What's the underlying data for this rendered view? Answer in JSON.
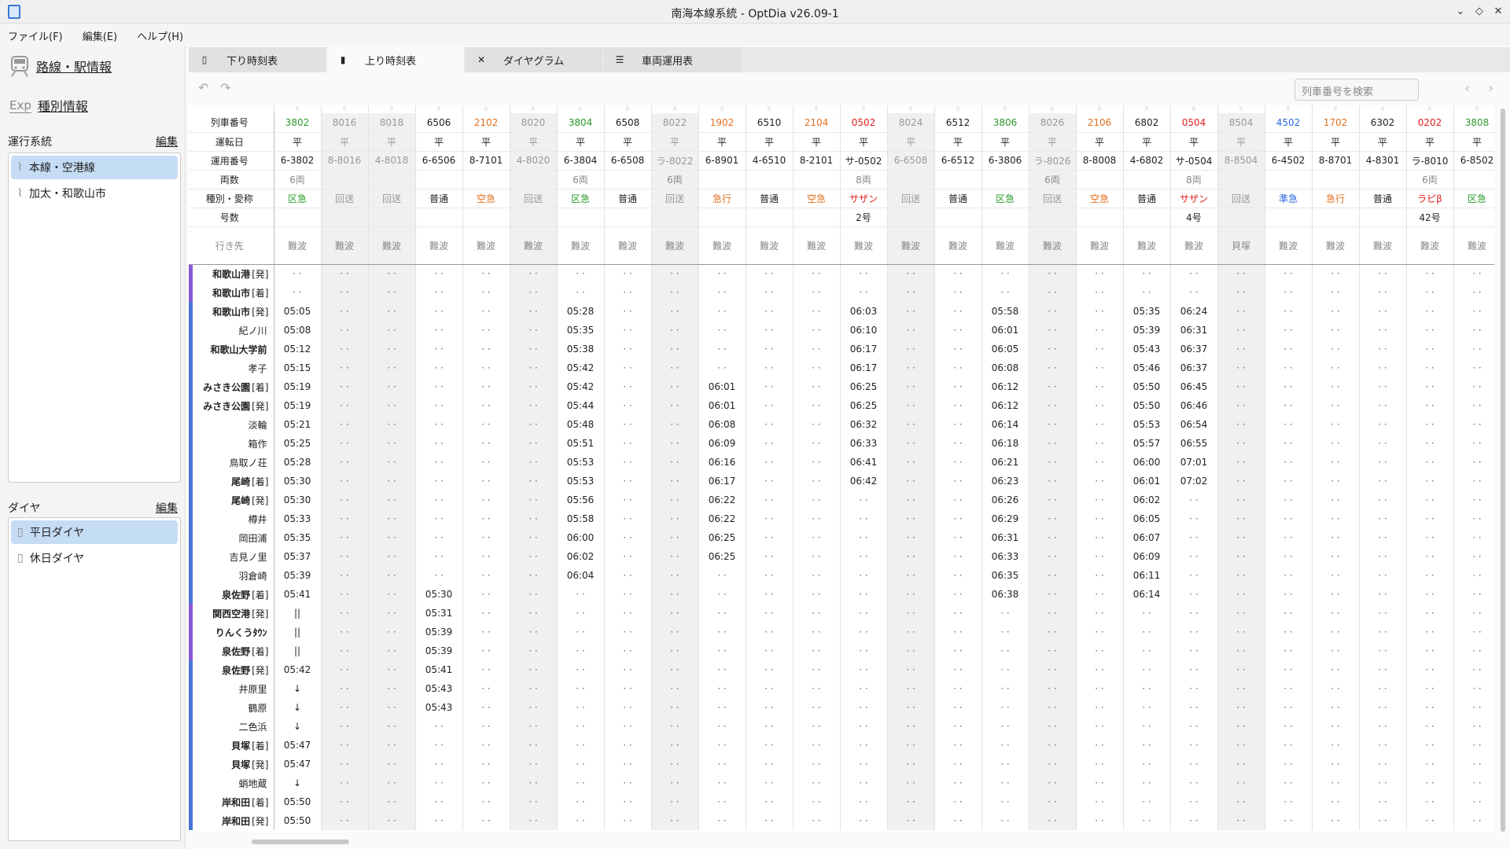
{
  "window": {
    "title": "南海本線系統 - OptDia v26.09-1",
    "controls": [
      "⌄",
      "◇",
      "✕"
    ]
  },
  "menu": [
    "ファイル(F)",
    "編集(E)",
    "ヘルプ(H)"
  ],
  "sidebar": {
    "route_info": "路線・駅情報",
    "type_info": "種別情報",
    "systems_label": "運行系統",
    "systems_edit": "編集",
    "systems": [
      "本線・空港線",
      "加太・和歌山市"
    ],
    "dia_label": "ダイヤ",
    "dia_edit": "編集",
    "dias": [
      "平日ダイヤ",
      "休日ダイヤ"
    ]
  },
  "tabs": [
    "下り時刻表",
    "上り時刻表",
    "ダイヤグラム",
    "車両運用表"
  ],
  "search": {
    "placeholder": "列車番号を検索"
  },
  "timetable": {
    "header_labels": [
      "列車番号",
      "運転日",
      "運用番号",
      "両数",
      "種別・愛称",
      "号数",
      "行き先"
    ],
    "trains": [
      {
        "no": "3802",
        "day": "平",
        "op": "6-3802",
        "cars": "6両",
        "type": "区急",
        "gou": "",
        "dest": "難波",
        "color": "#2a9a2a",
        "gray": false
      },
      {
        "no": "8016",
        "day": "平",
        "op": "8-8016",
        "cars": "",
        "type": "回送",
        "gou": "",
        "dest": "難波",
        "color": "#999999",
        "gray": true
      },
      {
        "no": "8018",
        "day": "平",
        "op": "4-8018",
        "cars": "",
        "type": "回送",
        "gou": "",
        "dest": "難波",
        "color": "#999999",
        "gray": true
      },
      {
        "no": "6506",
        "day": "平",
        "op": "6-6506",
        "cars": "",
        "type": "普通",
        "gou": "",
        "dest": "難波",
        "color": "#222222",
        "gray": false
      },
      {
        "no": "2102",
        "day": "平",
        "op": "8-7101",
        "cars": "",
        "type": "空急",
        "gou": "",
        "dest": "難波",
        "color": "#e07020",
        "gray": false
      },
      {
        "no": "8020",
        "day": "平",
        "op": "4-8020",
        "cars": "",
        "type": "回送",
        "gou": "",
        "dest": "難波",
        "color": "#999999",
        "gray": true
      },
      {
        "no": "3804",
        "day": "平",
        "op": "6-3804",
        "cars": "6両",
        "type": "区急",
        "gou": "",
        "dest": "難波",
        "color": "#2a9a2a",
        "gray": false
      },
      {
        "no": "6508",
        "day": "平",
        "op": "6-6508",
        "cars": "",
        "type": "普通",
        "gou": "",
        "dest": "難波",
        "color": "#222222",
        "gray": false
      },
      {
        "no": "8022",
        "day": "平",
        "op": "ラ-8022",
        "cars": "6両",
        "type": "回送",
        "gou": "",
        "dest": "難波",
        "color": "#999999",
        "gray": true
      },
      {
        "no": "1902",
        "day": "平",
        "op": "6-8901",
        "cars": "",
        "type": "急行",
        "gou": "",
        "dest": "難波",
        "color": "#e07020",
        "gray": false
      },
      {
        "no": "6510",
        "day": "平",
        "op": "4-6510",
        "cars": "",
        "type": "普通",
        "gou": "",
        "dest": "難波",
        "color": "#222222",
        "gray": false
      },
      {
        "no": "2104",
        "day": "平",
        "op": "8-2101",
        "cars": "",
        "type": "空急",
        "gou": "",
        "dest": "難波",
        "color": "#e07020",
        "gray": false
      },
      {
        "no": "0502",
        "day": "平",
        "op": "サ-0502",
        "cars": "8両",
        "type": "サザン",
        "gou": "2号",
        "dest": "難波",
        "color": "#e02020",
        "gray": false
      },
      {
        "no": "8024",
        "day": "平",
        "op": "6-6508",
        "cars": "",
        "type": "回送",
        "gou": "",
        "dest": "難波",
        "color": "#999999",
        "gray": true
      },
      {
        "no": "6512",
        "day": "平",
        "op": "6-6512",
        "cars": "",
        "type": "普通",
        "gou": "",
        "dest": "難波",
        "color": "#222222",
        "gray": false
      },
      {
        "no": "3806",
        "day": "平",
        "op": "6-3806",
        "cars": "",
        "type": "区急",
        "gou": "",
        "dest": "難波",
        "color": "#2a9a2a",
        "gray": false
      },
      {
        "no": "8026",
        "day": "平",
        "op": "ラ-8026",
        "cars": "6両",
        "type": "回送",
        "gou": "",
        "dest": "難波",
        "color": "#999999",
        "gray": true
      },
      {
        "no": "2106",
        "day": "平",
        "op": "8-8008",
        "cars": "",
        "type": "空急",
        "gou": "",
        "dest": "難波",
        "color": "#e07020",
        "gray": false
      },
      {
        "no": "6802",
        "day": "平",
        "op": "4-6802",
        "cars": "",
        "type": "普通",
        "gou": "",
        "dest": "難波",
        "color": "#222222",
        "gray": false
      },
      {
        "no": "0504",
        "day": "平",
        "op": "サ-0504",
        "cars": "8両",
        "type": "サザン",
        "gou": "4号",
        "dest": "難波",
        "color": "#e02020",
        "gray": false
      },
      {
        "no": "8504",
        "day": "平",
        "op": "8-8504",
        "cars": "",
        "type": "回送",
        "gou": "",
        "dest": "貝塚",
        "color": "#999999",
        "gray": true
      },
      {
        "no": "4502",
        "day": "平",
        "op": "6-4502",
        "cars": "",
        "type": "準急",
        "gou": "",
        "dest": "難波",
        "color": "#2a6ae0",
        "gray": false
      },
      {
        "no": "1702",
        "day": "平",
        "op": "8-8701",
        "cars": "",
        "type": "急行",
        "gou": "",
        "dest": "難波",
        "color": "#e07020",
        "gray": false
      },
      {
        "no": "6302",
        "day": "平",
        "op": "4-8301",
        "cars": "",
        "type": "普通",
        "gou": "",
        "dest": "難波",
        "color": "#222222",
        "gray": false
      },
      {
        "no": "0202",
        "day": "平",
        "op": "ラ-8010",
        "cars": "6両",
        "type": "ラピβ",
        "gou": "42号",
        "dest": "難波",
        "color": "#e02020",
        "gray": false
      },
      {
        "no": "3808",
        "day": "平",
        "op": "6-8502",
        "cars": "",
        "type": "区急",
        "gou": "",
        "dest": "難波",
        "color": "#2a9a2a",
        "gray": false
      }
    ],
    "stations": [
      {
        "name": "和歌山港",
        "suf": "[発]",
        "bold": true,
        "bar": "purple"
      },
      {
        "name": "和歌山市",
        "suf": "[着]",
        "bold": true,
        "bar": "purple"
      },
      {
        "name": "和歌山市",
        "suf": "[発]",
        "bold": true,
        "bar": "blue"
      },
      {
        "name": "紀ノ川",
        "suf": "",
        "bold": false,
        "bar": "blue"
      },
      {
        "name": "和歌山大学前",
        "suf": "",
        "bold": true,
        "bar": "blue"
      },
      {
        "name": "孝子",
        "suf": "",
        "bold": false,
        "bar": "blue"
      },
      {
        "name": "みさき公園",
        "suf": "[着]",
        "bold": true,
        "bar": "blue"
      },
      {
        "name": "みさき公園",
        "suf": "[発]",
        "bold": true,
        "bar": "blue"
      },
      {
        "name": "淡輪",
        "suf": "",
        "bold": false,
        "bar": "blue"
      },
      {
        "name": "箱作",
        "suf": "",
        "bold": false,
        "bar": "blue"
      },
      {
        "name": "鳥取ノ荘",
        "suf": "",
        "bold": false,
        "bar": "blue"
      },
      {
        "name": "尾崎",
        "suf": "[着]",
        "bold": true,
        "bar": "blue"
      },
      {
        "name": "尾崎",
        "suf": "[発]",
        "bold": true,
        "bar": "blue"
      },
      {
        "name": "樽井",
        "suf": "",
        "bold": false,
        "bar": "blue"
      },
      {
        "name": "岡田浦",
        "suf": "",
        "bold": false,
        "bar": "blue"
      },
      {
        "name": "吉見ノ里",
        "suf": "",
        "bold": false,
        "bar": "blue"
      },
      {
        "name": "羽倉崎",
        "suf": "",
        "bold": false,
        "bar": "blue"
      },
      {
        "name": "泉佐野",
        "suf": "[着]",
        "bold": true,
        "bar": "blue"
      },
      {
        "name": "関西空港",
        "suf": "[発]",
        "bold": true,
        "bar": "purple"
      },
      {
        "name": "りんくうﾀｳﾝ",
        "suf": "",
        "bold": true,
        "bar": "purple"
      },
      {
        "name": "泉佐野",
        "suf": "[着]",
        "bold": true,
        "bar": "purple"
      },
      {
        "name": "泉佐野",
        "suf": "[発]",
        "bold": true,
        "bar": "blue"
      },
      {
        "name": "井原里",
        "suf": "",
        "bold": false,
        "bar": "blue"
      },
      {
        "name": "鶴原",
        "suf": "",
        "bold": false,
        "bar": "blue"
      },
      {
        "name": "二色浜",
        "suf": "",
        "bold": false,
        "bar": "blue"
      },
      {
        "name": "貝塚",
        "suf": "[着]",
        "bold": true,
        "bar": "blue"
      },
      {
        "name": "貝塚",
        "suf": "[発]",
        "bold": true,
        "bar": "blue"
      },
      {
        "name": "蛸地蔵",
        "suf": "",
        "bold": false,
        "bar": "blue"
      },
      {
        "name": "岸和田",
        "suf": "[着]",
        "bold": true,
        "bar": "blue"
      },
      {
        "name": "岸和田",
        "suf": "[発]",
        "bold": true,
        "bar": "blue"
      }
    ],
    "times": [
      [
        "05:05",
        "05:08",
        "05:12",
        "05:15",
        "05:19",
        "05:19",
        "05:21",
        "05:25",
        "05:28",
        "05:30",
        "05:30",
        "05:33",
        "05:35",
        "05:37",
        "05:39",
        "05:41",
        "||",
        "||",
        "||",
        "05:42",
        "↓",
        "↓",
        "↓",
        "05:47",
        "05:47",
        "↓",
        "05:50",
        "05:50"
      ],
      [
        "05:30",
        "05:31",
        "05:39",
        "05:39",
        "05:41",
        "05:43",
        "05:43"
      ],
      [
        "05:28",
        "05:35",
        "05:38",
        "05:42",
        "05:42",
        "05:44",
        "05:48",
        "05:51",
        "05:53",
        "05:53",
        "05:56",
        "05:58",
        "06:00",
        "06:02",
        "06:04"
      ],
      [
        "06:01",
        "06:01",
        "06:08",
        "06:09",
        "06:16",
        "06:17",
        "06:22",
        "06:22",
        "06:25",
        "06:25"
      ],
      [
        "06:03",
        "06:10",
        "06:17",
        "06:17",
        "06:25",
        "06:25",
        "06:32",
        "06:33",
        "06:41",
        "06:42"
      ],
      [
        "05:58",
        "06:01",
        "06:05",
        "06:08",
        "06:12",
        "06:12",
        "06:14",
        "06:18",
        "06:21",
        "06:23",
        "06:26",
        "06:29",
        "06:31",
        "06:33",
        "06:35",
        "06:38"
      ],
      [
        "05:35",
        "05:39",
        "05:43",
        "05:46",
        "05:50",
        "05:50",
        "05:53",
        "05:57",
        "06:00",
        "06:01",
        "06:02",
        "06:05",
        "06:07",
        "06:09",
        "06:11",
        "06:14"
      ],
      [
        "06:24",
        "06:31",
        "06:37",
        "06:37",
        "06:45",
        "06:46",
        "06:54",
        "06:55",
        "07:01",
        "07:02"
      ]
    ]
  }
}
